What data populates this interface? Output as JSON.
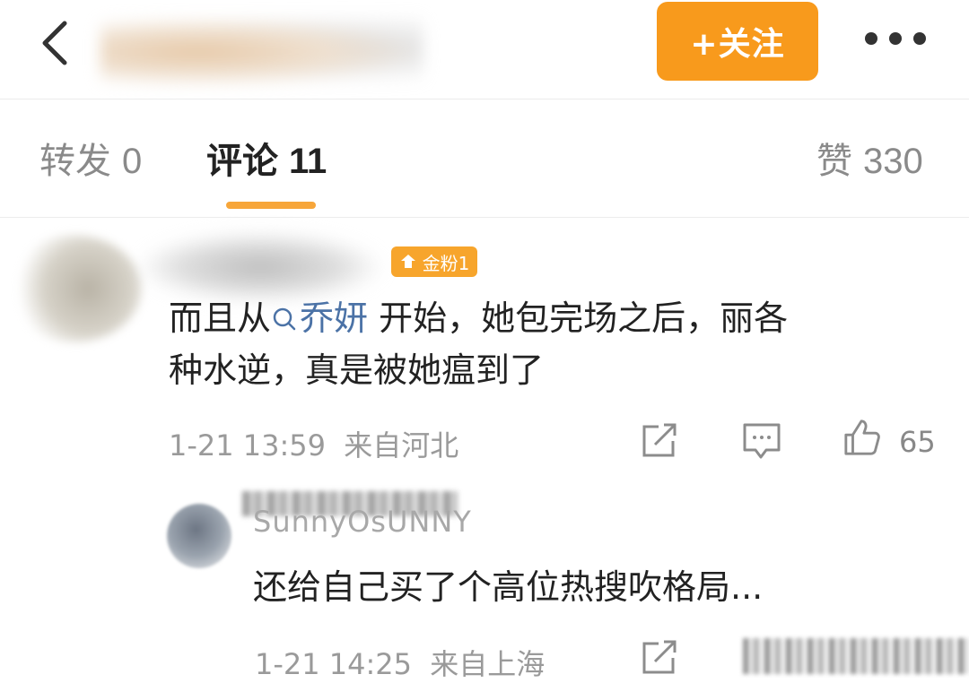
{
  "header": {
    "follow_label": "+关注"
  },
  "tabs": [
    {
      "label": "转发",
      "count": "0"
    },
    {
      "label": "评论",
      "count": "11"
    },
    {
      "label": "赞",
      "count": "330"
    }
  ],
  "comment": {
    "badge": "金粉1",
    "mention": "乔妍",
    "text_before": "而且从",
    "line1_after": " 开始，她包完场之后，丽各",
    "line2": "种水逆，真是被她瘟到了",
    "time": "1-21 13:59",
    "location": "来自河北",
    "likes": "65"
  },
  "reply": {
    "user": "SunnyOsUNNY",
    "text": "还给自己买了个高位热搜吹格局...",
    "time": "1-21 14:25",
    "location": "来自上海"
  }
}
